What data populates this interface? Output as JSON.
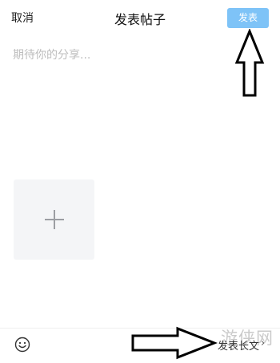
{
  "header": {
    "cancel_label": "取消",
    "title": "发表帖子",
    "post_label": "发表"
  },
  "editor": {
    "placeholder": "期待你的分享..."
  },
  "media": {
    "add_icon": "plus-icon"
  },
  "bottom_bar": {
    "emoji_icon": "smiley-icon",
    "long_text_label": "发表长文",
    "chevron": "›"
  },
  "watermark": "游侠网",
  "colors": {
    "post_button_bg": "#7ec3f7",
    "add_tile_bg": "#f4f5f7",
    "placeholder": "#bdbdbd"
  }
}
